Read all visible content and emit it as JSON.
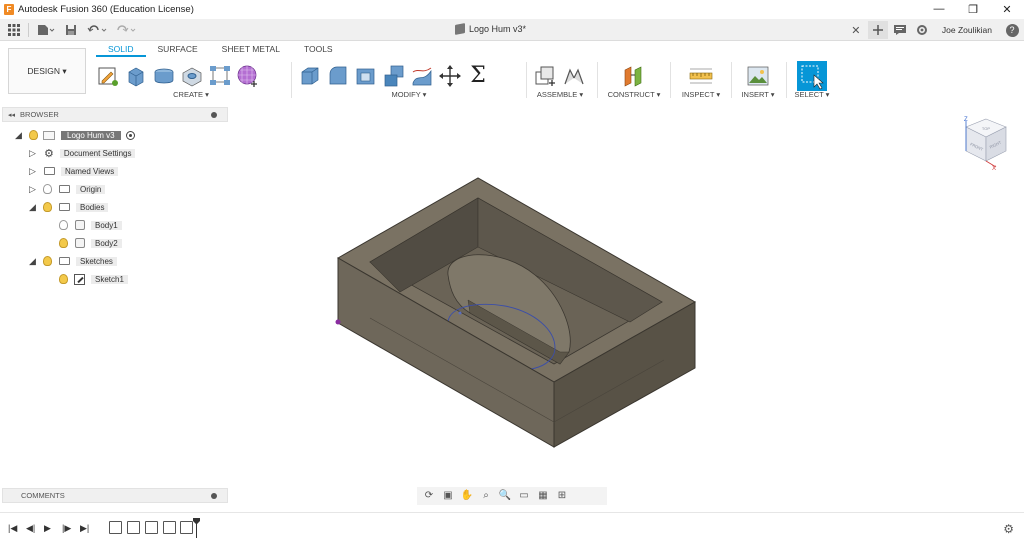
{
  "titlebar": {
    "logo": "F",
    "title": "Autodesk Fusion 360 (Education License)",
    "min": "—",
    "restore": "❐",
    "close": "✕"
  },
  "qat": {
    "doc_title": "Logo Hum v3*",
    "close_tab": "✕",
    "user": "Joe Zoulikian",
    "help": "?"
  },
  "ribbon": {
    "workspace": "DESIGN ▾",
    "tabs": [
      "SOLID",
      "SURFACE",
      "SHEET METAL",
      "TOOLS"
    ],
    "groups": {
      "create": "CREATE ▾",
      "modify": "MODIFY ▾",
      "assemble": "ASSEMBLE ▾",
      "construct": "CONSTRUCT ▾",
      "inspect": "INSPECT ▾",
      "insert": "INSERT ▾",
      "select": "SELECT ▾"
    },
    "sigma": "Σ",
    "accent": "#0696d7"
  },
  "browser": {
    "header": "BROWSER",
    "items": [
      {
        "label": "Logo Hum v3"
      },
      {
        "label": "Document Settings"
      },
      {
        "label": "Named Views"
      },
      {
        "label": "Origin"
      },
      {
        "label": "Bodies"
      },
      {
        "label": "Body1"
      },
      {
        "label": "Body2"
      },
      {
        "label": "Sketches"
      },
      {
        "label": "Sketch1"
      }
    ]
  },
  "comments": {
    "header": "COMMENTS"
  },
  "viewcube": {
    "z": "Z",
    "x": "X",
    "top": "TOP",
    "front": "FRONT",
    "right": "RIGHT"
  }
}
